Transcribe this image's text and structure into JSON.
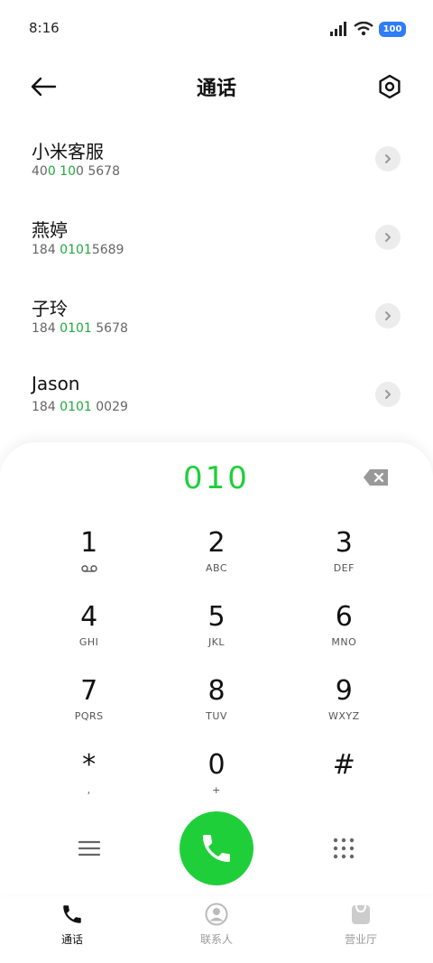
{
  "status": {
    "time": "8:16",
    "battery": "100"
  },
  "header": {
    "title": "通话"
  },
  "contacts": [
    {
      "name": "小米客服",
      "number_parts": [
        "40",
        "0 10",
        "0 5678"
      ]
    },
    {
      "name": "燕婷",
      "number_parts": [
        "184 ",
        "0101",
        "5689"
      ]
    },
    {
      "name": "子玲",
      "number_parts": [
        "184 ",
        "0101",
        " 5678"
      ]
    },
    {
      "name": "Jason",
      "number_parts": [
        "184 ",
        "0101",
        " 0029"
      ]
    }
  ],
  "dialer": {
    "number": "010",
    "keys": [
      {
        "digit": "1",
        "letters": ""
      },
      {
        "digit": "2",
        "letters": "ABC"
      },
      {
        "digit": "3",
        "letters": "DEF"
      },
      {
        "digit": "4",
        "letters": "GHI"
      },
      {
        "digit": "5",
        "letters": "JKL"
      },
      {
        "digit": "6",
        "letters": "MNO"
      },
      {
        "digit": "7",
        "letters": "PQRS"
      },
      {
        "digit": "8",
        "letters": "TUV"
      },
      {
        "digit": "9",
        "letters": "WXYZ"
      },
      {
        "digit": "*",
        "letters": ","
      },
      {
        "digit": "0",
        "letters": "+"
      },
      {
        "digit": "#",
        "letters": ""
      }
    ]
  },
  "nav": {
    "calls": "通话",
    "contacts": "联系人",
    "service": "营业厅"
  },
  "colors": {
    "accent": "#1fcf3a",
    "highlight": "#1faa3b",
    "battery": "#2f7cf6"
  }
}
